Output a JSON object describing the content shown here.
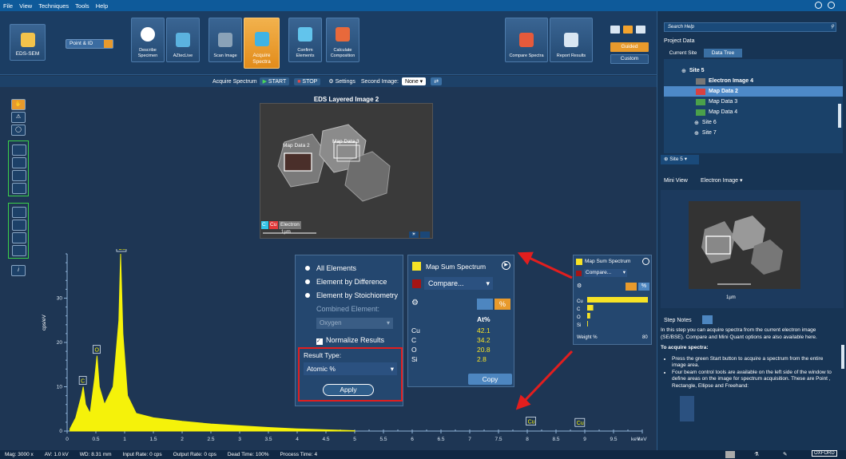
{
  "menu": [
    "File",
    "View",
    "Techniques",
    "Tools",
    "Help"
  ],
  "ribbon": {
    "app_button": "EDS-SEM",
    "mode_select": "Point & ID",
    "steps": [
      "Describe Specimen",
      "AZtecLive",
      "Scan Image",
      "Acquire Spectra",
      "Confirm Elements",
      "Calculate Composition"
    ],
    "right_buttons": [
      "Compare Spectra",
      "Report Results"
    ],
    "guided": "Guided",
    "custom": "Custom"
  },
  "acquire_bar": {
    "label": "Acquire Spectrum",
    "start": "START",
    "stop": "STOP",
    "settings": "Settings",
    "second_image_label": "Second Image:",
    "second_image_value": "None"
  },
  "image": {
    "title": "EDS Layered Image 2",
    "map_label_1": "Map Data 2",
    "map_label_2": "Map Data 3",
    "legend": [
      "C",
      "Cu",
      "Electron"
    ],
    "scale": "1µm"
  },
  "options": {
    "all_elements": "All Elements",
    "by_difference": "Element by Difference",
    "by_stoich": "Element by Stoichiometry",
    "combined": "Combined Element:",
    "combined_value": "Oxygen",
    "normalize": "Normalize Results",
    "result_type_label": "Result Type:",
    "result_type_value": "Atomic %",
    "apply": "Apply"
  },
  "results": {
    "title": "Map Sum Spectrum",
    "compare": "Compare...",
    "col_header": "At%",
    "rows": [
      {
        "el": "Cu",
        "val": "42.1"
      },
      {
        "el": "C",
        "val": "34.2"
      },
      {
        "el": "O",
        "val": "20.8"
      },
      {
        "el": "Si",
        "val": "2.8"
      }
    ],
    "copy": "Copy"
  },
  "mini_quant": {
    "title": "Map Sum Spectrum",
    "compare": "Compare...",
    "elements": [
      "Cu",
      "C",
      "O",
      "Si"
    ],
    "weights": [
      80,
      8,
      4,
      1
    ],
    "xlabel": "Weight %",
    "xmax": "80"
  },
  "chart_data": {
    "type": "line",
    "ylabel": "cps/eV",
    "xlabel": "keV",
    "xlim": [
      0,
      10
    ],
    "ylim": [
      0,
      40
    ],
    "x_ticks": [
      "0",
      "0.5",
      "1",
      "1.5",
      "2",
      "2.5",
      "3",
      "3.5",
      "4",
      "4.5",
      "5",
      "5.5",
      "6",
      "6.5",
      "7",
      "7.5",
      "8",
      "8.5",
      "9",
      "9.5",
      "keV"
    ],
    "y_ticks": [
      "0",
      "10",
      "20",
      "30"
    ],
    "peaks": [
      {
        "label": "C",
        "x": 0.28,
        "y": 10
      },
      {
        "label": "O",
        "x": 0.52,
        "y": 17
      },
      {
        "label": "Cu",
        "x": 0.93,
        "y": 40
      },
      {
        "label": "Cu",
        "x": 8.05,
        "y": 0.8
      },
      {
        "label": "Cu",
        "x": 8.9,
        "y": 0.5
      }
    ],
    "series": [
      {
        "x": [
          0.05,
          0.15,
          0.25,
          0.28,
          0.32,
          0.4,
          0.48,
          0.52,
          0.56,
          0.65,
          0.8,
          0.9,
          0.93,
          0.97,
          1.05,
          1.2,
          1.5,
          2,
          2.5,
          3,
          3.5,
          4,
          4.5,
          5
        ],
        "y": [
          0.5,
          3,
          8,
          10,
          6,
          4,
          12,
          17,
          10,
          6,
          10,
          25,
          40,
          22,
          8,
          4,
          3,
          2.2,
          1.6,
          1.2,
          0.8,
          0.5,
          0.3,
          0.1
        ]
      }
    ]
  },
  "right": {
    "search": "Search Help",
    "project_data": "Project Data",
    "tabs": [
      "Current Site",
      "Data Tree"
    ],
    "tree": [
      "Site 5",
      "Electron Image 4",
      "Map Data 2",
      "Map Data 3",
      "Map Data 4",
      "Site 6",
      "Site 7"
    ],
    "site_select": "Site 5",
    "mini_view": "Mini View",
    "mini_select": "Electron Image",
    "mini_scale": "1µm",
    "step_notes": "Step Notes",
    "notes_p1": "In this step you can acquire spectra from the current electron image (SE/BSE). Compare and Mini Quant options are also available here.",
    "notes_h": "To acquire spectra:",
    "notes_b1": "Press the green Start button to acquire a spectrum from the entire image area.",
    "notes_b2": "Four beam control tools are available on the left side of the window to define areas on the image for spectrum acquisition. These are Point , Rectangle, Ellipse and Freehand:"
  },
  "status": {
    "mag": "Mag: 3000 x",
    "av": "AV: 1.0 kV",
    "wd": "WD: 8.31 mm",
    "input": "Input Rate: 0 cps",
    "output": "Output Rate: 0 cps",
    "dead": "Dead Time: 100%",
    "process": "Process Time: 4",
    "logo": "OXFORD"
  }
}
